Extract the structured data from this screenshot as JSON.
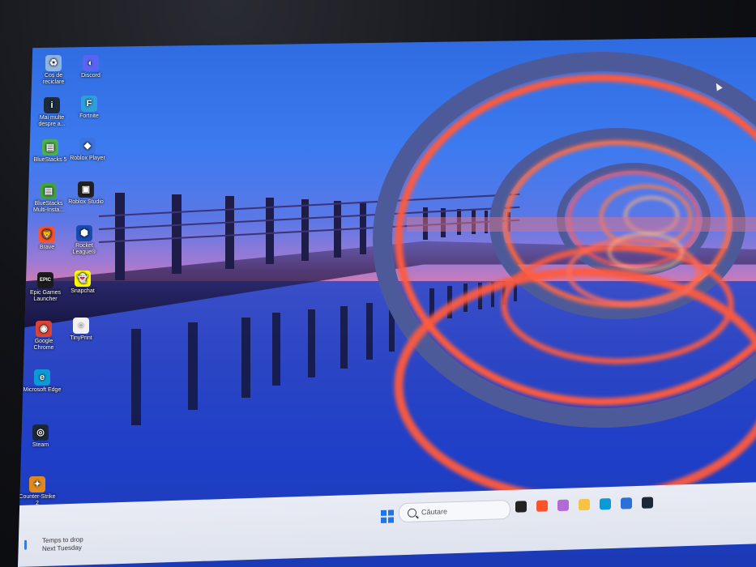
{
  "desktop": {
    "icons": [
      {
        "label": "Coș de reciclare",
        "icon": "recycle-bin-icon",
        "color": "#8fb4e0"
      },
      {
        "label": "Discord",
        "icon": "discord-icon",
        "color": "#5865f2"
      },
      {
        "label": "Mai multe despre a...",
        "icon": "info-icon",
        "color": "#1d2a3a"
      },
      {
        "label": "Fortnite",
        "icon": "fortnite-icon",
        "color": "#2e9fdc"
      },
      {
        "label": "BlueStacks 5",
        "icon": "bluestacks-icon",
        "color": "#4caf50"
      },
      {
        "label": "Roblox Player",
        "icon": "roblox-icon",
        "color": "#3b73e0"
      },
      {
        "label": "BlueStacks Multi-Insta...",
        "icon": "bluestacks-multi-icon",
        "color": "#43a047"
      },
      {
        "label": "Roblox Studio",
        "icon": "roblox-studio-icon",
        "color": "#222222"
      },
      {
        "label": "Brave",
        "icon": "brave-icon",
        "color": "#fb542b"
      },
      {
        "label": "Rocket League®",
        "icon": "rocket-league-icon",
        "color": "#1a4bb0"
      },
      {
        "label": "Epic Games Launcher",
        "icon": "epic-games-icon",
        "color": "#1b1b1b"
      },
      {
        "label": "Snapchat",
        "icon": "snapchat-icon",
        "color": "#fffc00"
      },
      {
        "label": "Google Chrome",
        "icon": "chrome-icon",
        "color": "#db4437"
      },
      {
        "label": "TinyPrint",
        "icon": "tinyprint-icon",
        "color": "#f2f2f2"
      },
      {
        "label": "Microsoft Edge",
        "icon": "edge-icon",
        "color": "#0c9ad6"
      },
      {
        "label": "Steam",
        "icon": "steam-icon",
        "color": "#1b2838"
      },
      {
        "label": "Counter-Strike 2",
        "icon": "counter-strike-icon",
        "color": "#e08a1e"
      }
    ]
  },
  "taskbar": {
    "search_placeholder": "Căutare",
    "weather_line1": "Temps to drop",
    "weather_line2": "Next Tuesday",
    "apps": [
      {
        "name": "task-view-icon",
        "color": "#222222"
      },
      {
        "name": "brave-taskbar-icon",
        "color": "#fb542b"
      },
      {
        "name": "copilot-icon",
        "color": "#b36ad8"
      },
      {
        "name": "file-explorer-icon",
        "color": "#f6c343"
      },
      {
        "name": "edge-taskbar-icon",
        "color": "#0c9ad6"
      },
      {
        "name": "store-icon",
        "color": "#2b6fd8"
      },
      {
        "name": "steam-taskbar-icon",
        "color": "#1b2838"
      }
    ]
  }
}
